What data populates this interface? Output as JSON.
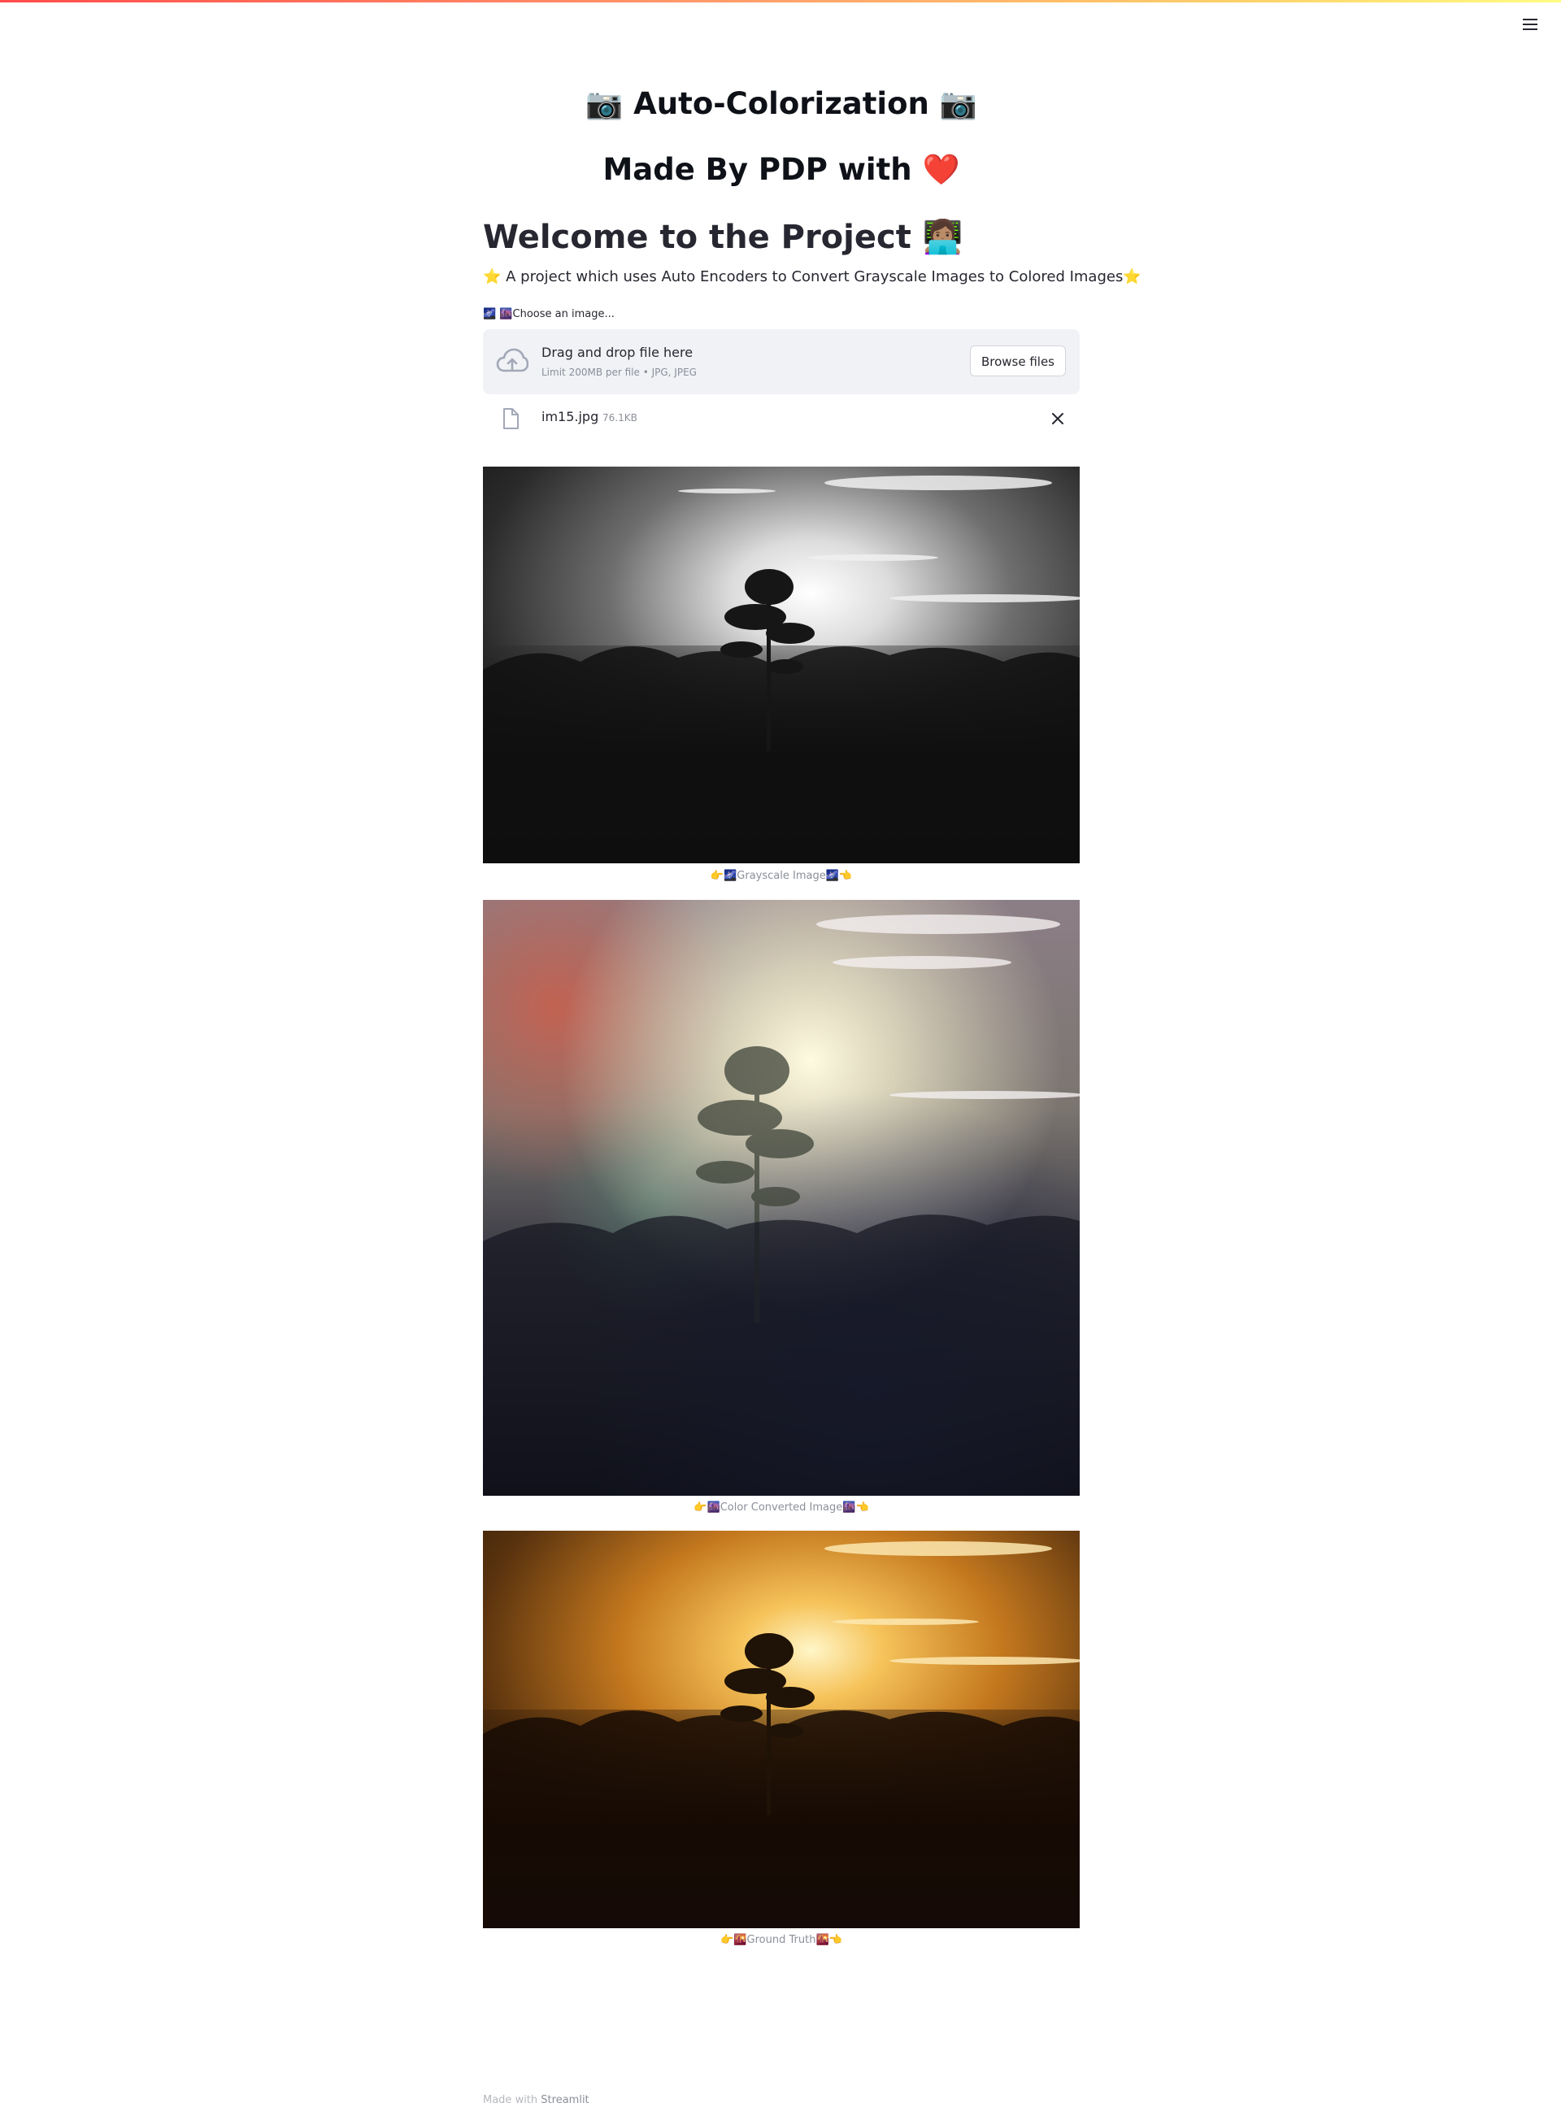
{
  "header": {
    "accent_gradient": [
      "#ff4b4b",
      "#fffd80"
    ],
    "menu_icon": "hamburger-menu-icon"
  },
  "titles": {
    "app_title": "📷 Auto-Colorization 📷",
    "made_by": "Made By PDP with ❤️"
  },
  "intro": {
    "heading": "Welcome to the Project 👩🏽‍💻",
    "description": "⭐ A project which uses Auto Encoders to Convert Grayscale Images to Colored Images⭐"
  },
  "uploader": {
    "label": "🌌 🌆Choose an image...",
    "drop_text": "Drag and drop file here",
    "limit_text": "Limit 200MB per file • JPG, JPEG",
    "browse_label": "Browse files",
    "icon": "cloud-upload-icon"
  },
  "uploaded_file": {
    "name": "im15.jpg",
    "size": "76.1KB",
    "icon": "file-icon",
    "remove_icon": "close-icon"
  },
  "images": [
    {
      "caption": "👉🌌Grayscale Image🌌👈",
      "style": "grayscale"
    },
    {
      "caption": "👉🌆Color Converted Image🌆👈",
      "style": "colorized"
    },
    {
      "caption": "👉🌇Ground Truth🌇👈",
      "style": "ground-truth"
    }
  ],
  "footer": {
    "prefix": "Made with",
    "brand": "Streamlit"
  }
}
